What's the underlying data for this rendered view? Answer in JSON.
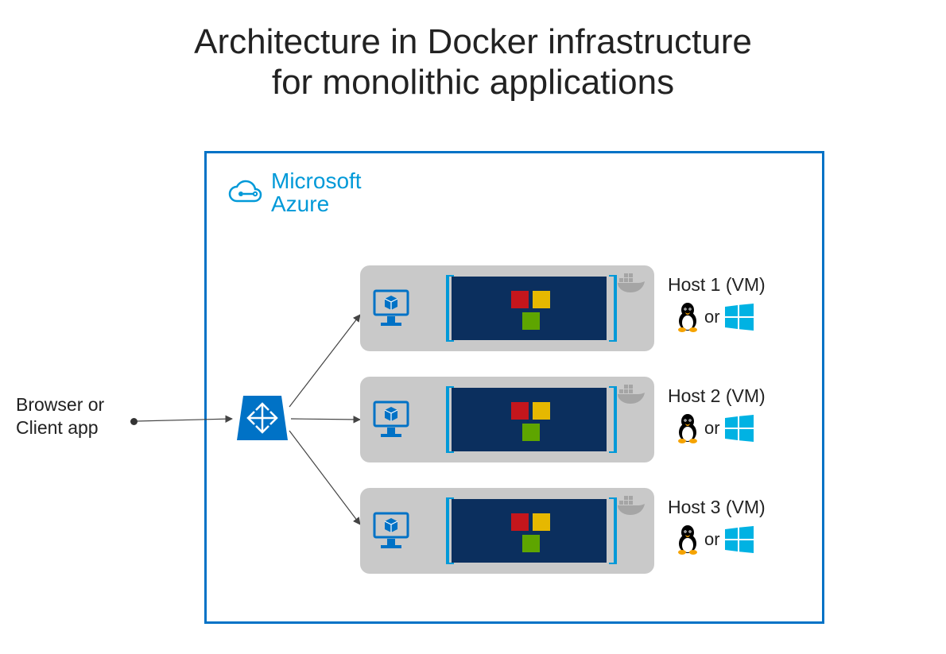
{
  "title_line1": "Architecture in Docker infrastructure",
  "title_line2": "for monolithic applications",
  "client_label_line1": "Browser or",
  "client_label_line2": "Client app",
  "azure_brand_line1": "Microsoft",
  "azure_brand_line2": "Azure",
  "hosts": [
    {
      "label": "Host 1 (VM)",
      "or": "or"
    },
    {
      "label": "Host 2 (VM)",
      "or": "or"
    },
    {
      "label": "Host 3 (VM)",
      "or": "or"
    }
  ],
  "colors": {
    "azure_blue": "#0072c6",
    "azure_cyan": "#0099d8",
    "container_navy": "#0b2f5e",
    "grey_pill": "#c9c9c9",
    "red": "#c4161c",
    "yellow": "#e6b800",
    "green": "#5ea500"
  }
}
